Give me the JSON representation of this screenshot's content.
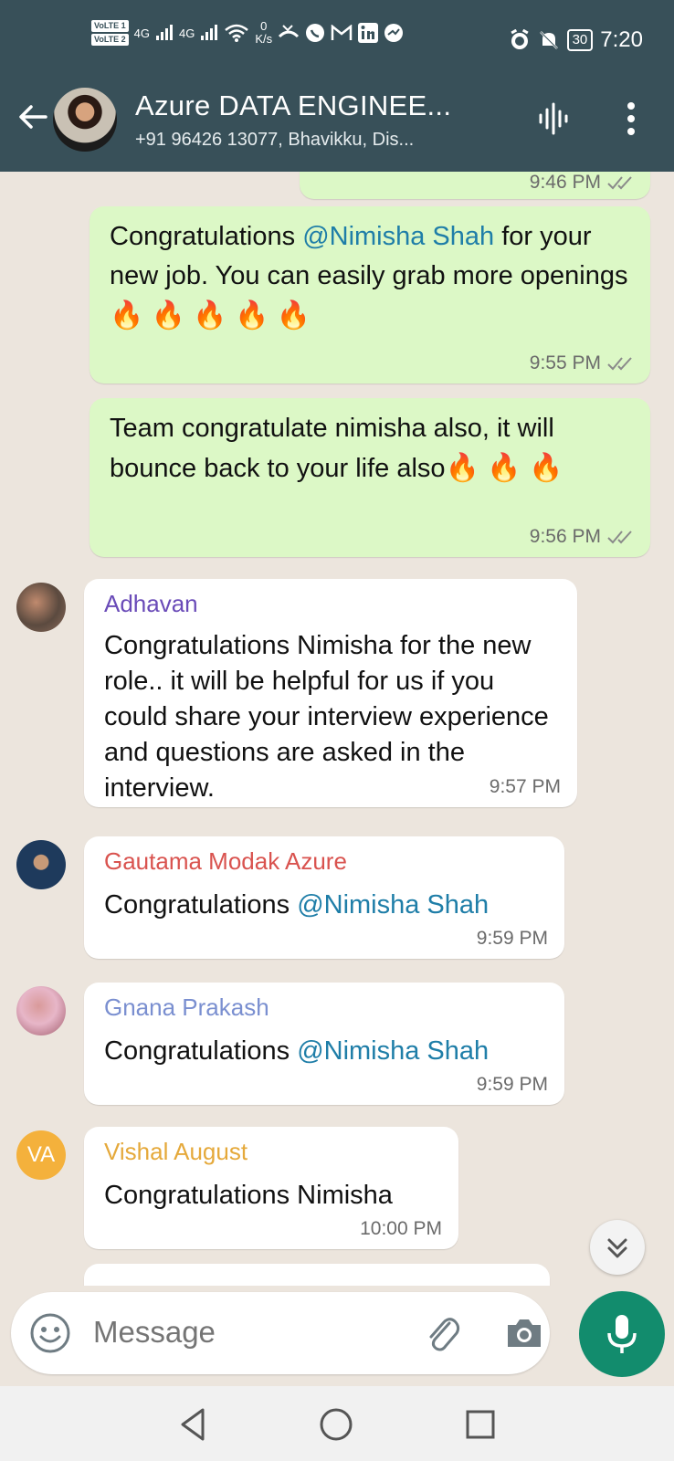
{
  "status_bar": {
    "volte1": "VoLTE 1",
    "volte2": "VoLTE 2",
    "net1": "4G",
    "net2": "4G",
    "speed_value": "0",
    "speed_unit": "K/s",
    "battery": "30",
    "time": "7:20"
  },
  "header": {
    "title": "Azure DATA ENGINEE...",
    "subtitle": "+91 96426 13077, Bhavikku, Dis..."
  },
  "messages": {
    "partial_time": "9:46 PM",
    "m1": {
      "pre": "Congratulations ",
      "mention": "@Nimisha Shah",
      "post": " for your new job. You can easily grab more openings",
      "emoji": "🔥 🔥 🔥 🔥 🔥",
      "time": "9:55 PM"
    },
    "m2": {
      "text": "Team congratulate nimisha also, it will bounce back to your life also",
      "emoji": "🔥 🔥 🔥",
      "time": "9:56 PM"
    },
    "m3": {
      "sender": "Adhavan",
      "text": "Congratulations Nimisha for the new role.. it will be helpful for us if you could share your interview experience and questions are asked in the interview.",
      "time": "9:57 PM"
    },
    "m4": {
      "sender": "Gautama Modak Azure",
      "pre": "Congratulations ",
      "mention": "@Nimisha Shah",
      "time": "9:59 PM"
    },
    "m5": {
      "sender": "Gnana Prakash",
      "pre": "Congratulations ",
      "mention": "@Nimisha Shah",
      "time": "9:59 PM"
    },
    "m6": {
      "sender": "Vishal August",
      "avatar_initials": "VA",
      "text": "Congratulations Nimisha",
      "time": "10:00 PM"
    }
  },
  "input": {
    "placeholder": "Message"
  },
  "colors": {
    "header_bg": "#385059",
    "outgoing_bubble": "#dcf8c6",
    "incoming_bubble": "#ffffff",
    "mention": "#1f7ea8",
    "sender_adhavan": "#6a4bb8",
    "sender_gautama": "#d9534f",
    "sender_gnana": "#7a8fd0",
    "sender_vishal": "#e5a93b",
    "mic_button": "#128c6d"
  },
  "icons": [
    "back-arrow-icon",
    "voice-wave-icon",
    "more-vert-icon",
    "double-tick-icon",
    "fire-emoji",
    "chevron-double-down-icon",
    "emoji-icon",
    "attach-clip-icon",
    "camera-icon",
    "mic-icon",
    "nav-back-icon",
    "nav-home-icon",
    "nav-recent-icon"
  ]
}
